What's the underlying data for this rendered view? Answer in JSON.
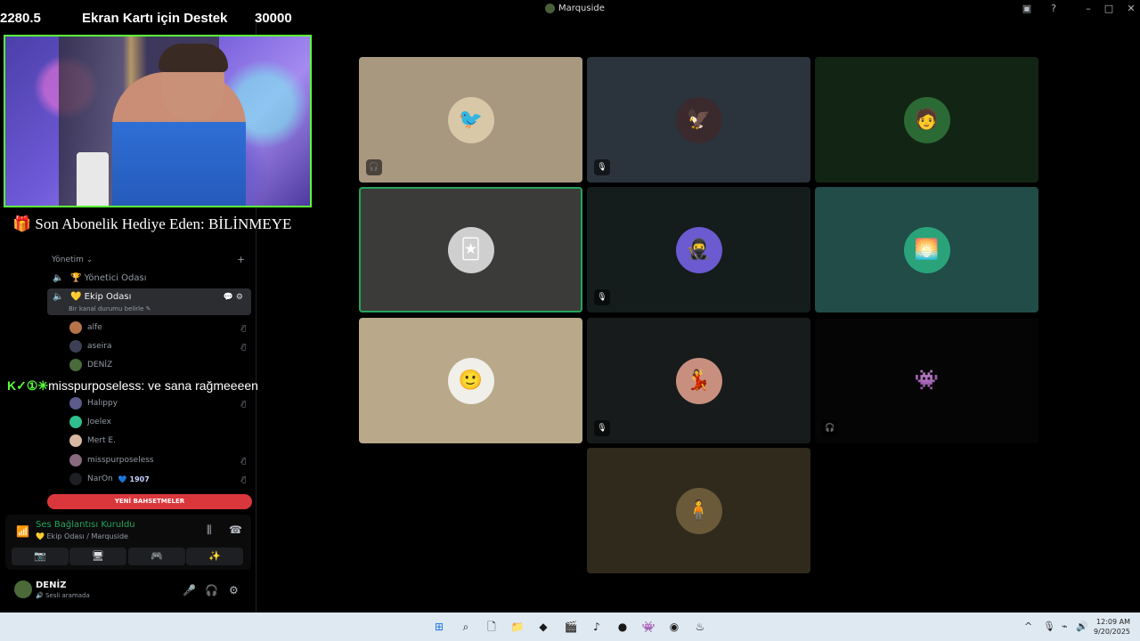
{
  "titlebar": {
    "server_name": "Marquside"
  },
  "overlay": {
    "left_value": "2280.5",
    "goal_title": "Ekran Kartı için Destek",
    "goal_target": "30000",
    "gift_text": "Son Abonelik Hediye Eden: BİLİNMEYE",
    "chat_user": "misspurposeless:",
    "chat_message": "ve sana rağmeeeen",
    "chat_prefix": "K✓①✳"
  },
  "sidebar": {
    "category": "Yönetim",
    "channels": [
      {
        "name": "🏆 Yönetici Odası"
      },
      {
        "name": "💛 Ekip Odası",
        "subtitle": "Bir kanal durumu belirle ✎"
      }
    ],
    "members": [
      {
        "name": "alfe",
        "color": "#b5734a"
      },
      {
        "name": "aseira",
        "color": "#3c3f55"
      },
      {
        "name": "DENİZ",
        "color": "#4a6a3a"
      },
      {
        "name": "Halıppy",
        "color": "#5b5a8a"
      },
      {
        "name": "Joelex",
        "color": "#2fbf8e"
      },
      {
        "name": "Mert E.",
        "color": "#d8b8a0"
      },
      {
        "name": "misspurposeless",
        "color": "#8a6a80"
      },
      {
        "name": "NarOn",
        "color": "#1e1f22",
        "badge": "💙 1907"
      }
    ],
    "mentions_label": "YENİ BAHSETMELER"
  },
  "voice_panel": {
    "status": "Ses Bağlantısı Kuruldu",
    "channel": "💛 Ekip Odası / Marquside"
  },
  "user_panel": {
    "name": "DENİZ",
    "status": "🔊 Sesli aramada"
  },
  "grid": {
    "tiles": [
      {
        "bg": "#a99880",
        "avatar_bg": "#d9c8a8",
        "glyph": "🐦",
        "indicator": "🎧",
        "speaking": false
      },
      {
        "bg": "#2b333c",
        "avatar_bg": "#3a2a2e",
        "glyph": "🦅",
        "indicator": "🎙",
        "speaking": false
      },
      {
        "bg": "#122515",
        "avatar_bg": "#2c6a35",
        "glyph": "🧑",
        "indicator": "",
        "speaking": false
      },
      {
        "bg": "#3b3b3a",
        "avatar_bg": "#cfcfcf",
        "glyph": "🃏",
        "indicator": "",
        "speaking": true
      },
      {
        "bg": "#141c1c",
        "avatar_bg": "#6b5ad0",
        "glyph": "🥷",
        "indicator": "🎙",
        "speaking": false
      },
      {
        "bg": "#214c47",
        "avatar_bg": "#2aa37a",
        "glyph": "🌅",
        "indicator": "",
        "speaking": false
      },
      {
        "bg": "#b9a88a",
        "avatar_bg": "#f0efe9",
        "glyph": "🙂",
        "indicator": "",
        "speaking": false
      },
      {
        "bg": "#171b1b",
        "avatar_bg": "#c88f7f",
        "glyph": "💃",
        "indicator": "🎙",
        "speaking": false
      },
      {
        "bg": "#050505",
        "avatar_bg": "#050505",
        "glyph": "👾",
        "indicator": "🎧",
        "speaking": false
      },
      {
        "bg": "#2f2a1c",
        "avatar_bg": "#6a5a3a",
        "glyph": "🧍",
        "indicator": "",
        "speaking": false
      }
    ]
  },
  "taskbar": {
    "time": "12:09 AM",
    "date": "9/20/2025"
  }
}
